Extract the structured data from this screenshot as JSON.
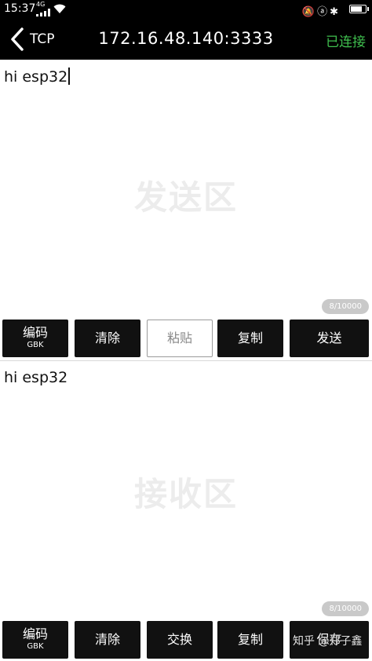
{
  "status_bar": {
    "time": "15:37",
    "network": "4G",
    "right_icons": "🔕ⓐ✱"
  },
  "nav": {
    "protocol": "TCP",
    "address": "172.16.48.140:3333",
    "connection_status": "已连接",
    "status_color": "#3fbf4e"
  },
  "send": {
    "text": "hi esp32",
    "watermark": "发送区",
    "counter": "8/10000",
    "buttons": {
      "encoding": "编码",
      "encoding_sub": "GBK",
      "clear": "清除",
      "paste": "粘贴",
      "copy": "复制",
      "send": "发送"
    }
  },
  "receive": {
    "text": "hi esp32",
    "watermark": "接收区",
    "counter": "8/10000",
    "buttons": {
      "encoding": "编码",
      "encoding_sub": "GBK",
      "clear": "清除",
      "swap": "交换",
      "copy": "复制",
      "save": "保存"
    }
  },
  "footer_watermark": "知乎 @郑子鑫"
}
